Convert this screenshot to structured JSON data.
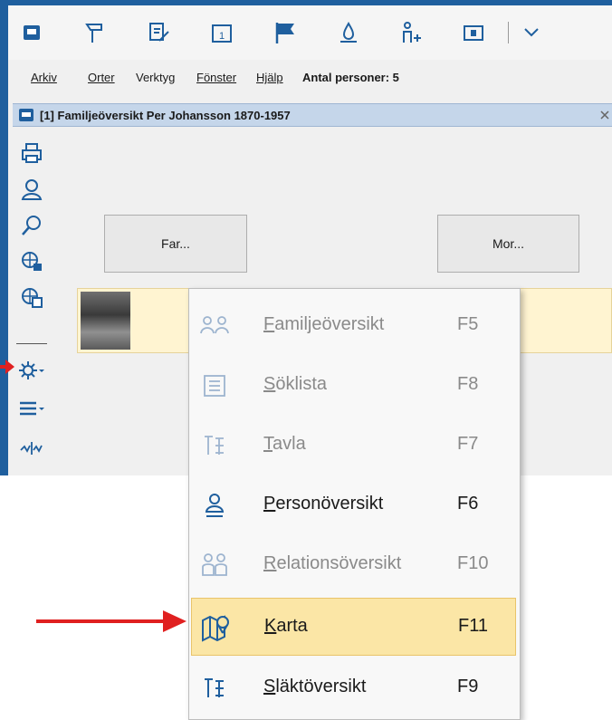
{
  "menubar": {
    "arkiv": "Arkiv",
    "orter": "Orter",
    "verktyg": "Verktyg",
    "fonster": "Fönster",
    "hjalp": "Hjälp",
    "antal": "Antal personer: 5"
  },
  "doc": {
    "title": "[1] Familjeöversikt Per Johansson 1870-1957"
  },
  "parents": {
    "far": "Far...",
    "mor": "Mor..."
  },
  "menu": {
    "items": [
      {
        "label": "Familjeöversikt",
        "key": "F5"
      },
      {
        "label": "Söklista",
        "key": "F8"
      },
      {
        "label": "Tavla",
        "key": "F7"
      },
      {
        "label": "Personöversikt",
        "key": "F6"
      },
      {
        "label": "Relationsöversikt",
        "key": "F10"
      },
      {
        "label": "Karta",
        "key": "F11"
      },
      {
        "label": "Släktöversikt",
        "key": "F9"
      }
    ]
  },
  "colors": {
    "accent": "#1f5f9e",
    "selected": "#fbe6a6",
    "arrow": "#e02020"
  },
  "icons": [
    "archive-icon",
    "place-icon",
    "edit-icon",
    "calendar-icon",
    "flag-icon",
    "water-icon",
    "add-person-icon",
    "card-icon",
    "dropdown-icon",
    "print-icon",
    "person-icon",
    "search-icon",
    "globe-lock-icon",
    "globe-copy-icon",
    "settings-icon",
    "menu-icon",
    "chart-icon"
  ]
}
